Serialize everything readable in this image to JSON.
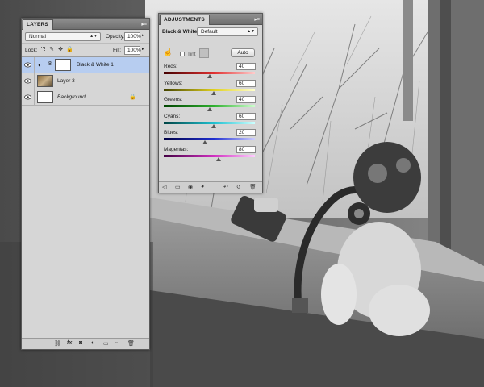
{
  "layers_panel": {
    "tab_label": "LAYERS",
    "blend_mode": "Normal",
    "opacity_label": "Opacity:",
    "opacity_value": "100%",
    "lock_label": "Lock:",
    "fill_label": "Fill:",
    "fill_value": "100%",
    "layers": [
      {
        "name": "Black & White 1",
        "selected": true,
        "icon": "adjustment-layer-icon"
      },
      {
        "name": "Layer 3",
        "selected": false,
        "icon": "photo-thumbnail"
      },
      {
        "name": "Background",
        "selected": false,
        "icon": "white-thumbnail",
        "locked": true
      }
    ],
    "footer_icons": [
      "link-icon",
      "fx-icon",
      "mask-icon",
      "new-adjustment-icon",
      "group-icon",
      "new-layer-icon",
      "trash-icon"
    ]
  },
  "adjustments_panel": {
    "tab_label": "ADJUSTMENTS",
    "title": "Black & White",
    "preset": "Default",
    "tint_label": "Tint",
    "auto_label": "Auto",
    "sliders": [
      {
        "label": "Reds:",
        "value": "40",
        "fraction": 0.5
      },
      {
        "label": "Yellows:",
        "value": "60",
        "fraction": 0.55
      },
      {
        "label": "Greens:",
        "value": "40",
        "fraction": 0.5
      },
      {
        "label": "Cyans:",
        "value": "60",
        "fraction": 0.55
      },
      {
        "label": "Blues:",
        "value": "20",
        "fraction": 0.45
      },
      {
        "label": "Magentas:",
        "value": "80",
        "fraction": 0.6
      }
    ],
    "footer_icons": [
      "back-icon",
      "expand-icon",
      "clip-icon",
      "visibility-icon",
      "previous-state-icon",
      "reset-icon",
      "trash-icon"
    ]
  },
  "colors": {
    "panel_bg": "#d6d6d6",
    "selected_row": "#b7cdf0",
    "reds_track": "#e03030",
    "yellows_track": "#e0d020",
    "greens_track": "#30b030",
    "cyans_track": "#20c0d0",
    "blues_track": "#2030d0",
    "magentas_track": "#d030c0"
  }
}
